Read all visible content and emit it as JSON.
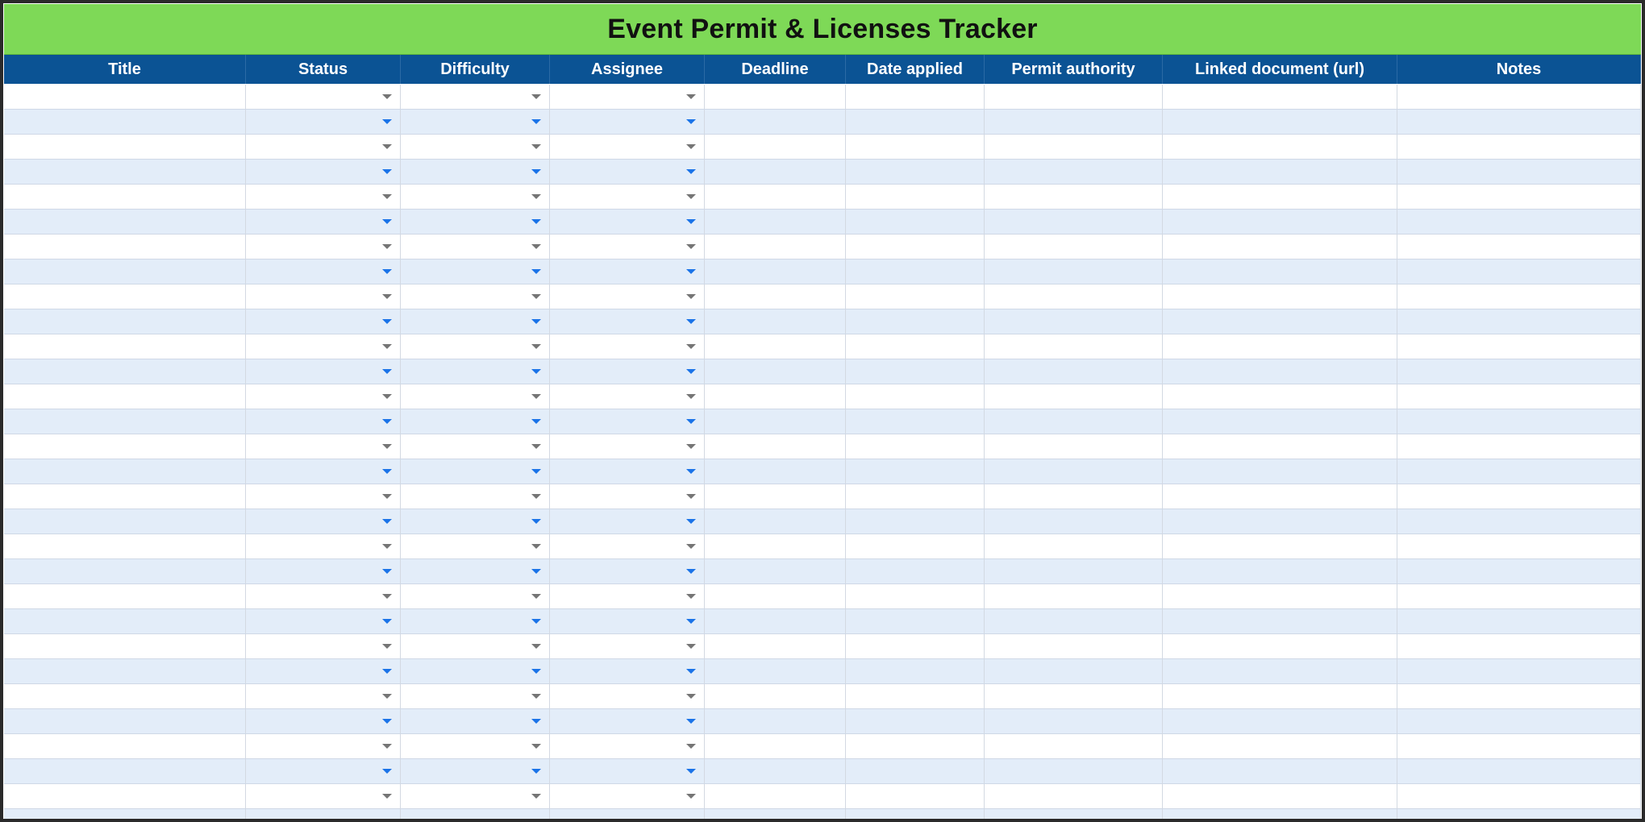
{
  "sheet": {
    "title": "Event Permit & Licenses Tracker"
  },
  "columns": [
    {
      "key": "title",
      "label": "Title",
      "dropdown": false
    },
    {
      "key": "status",
      "label": "Status",
      "dropdown": true
    },
    {
      "key": "difficulty",
      "label": "Difficulty",
      "dropdown": true
    },
    {
      "key": "assignee",
      "label": "Assignee",
      "dropdown": true
    },
    {
      "key": "deadline",
      "label": "Deadline",
      "dropdown": false
    },
    {
      "key": "date_applied",
      "label": "Date applied",
      "dropdown": false
    },
    {
      "key": "permit_authority",
      "label": "Permit authority",
      "dropdown": false
    },
    {
      "key": "linked_document",
      "label": "Linked document (url)",
      "dropdown": false
    },
    {
      "key": "notes",
      "label": "Notes",
      "dropdown": false
    }
  ],
  "rows": [
    {},
    {},
    {},
    {},
    {},
    {},
    {},
    {},
    {},
    {},
    {},
    {},
    {},
    {},
    {},
    {},
    {},
    {},
    {},
    {},
    {},
    {},
    {},
    {},
    {},
    {},
    {},
    {},
    {},
    {}
  ],
  "colors": {
    "title_bar": "#7ed957",
    "header_bar": "#0b5394",
    "band_alt": "#e3edf9",
    "dropdown_plain": "#757575",
    "dropdown_alt": "#1a73e8"
  },
  "icons": {
    "dropdown": "chevron-down-icon"
  }
}
